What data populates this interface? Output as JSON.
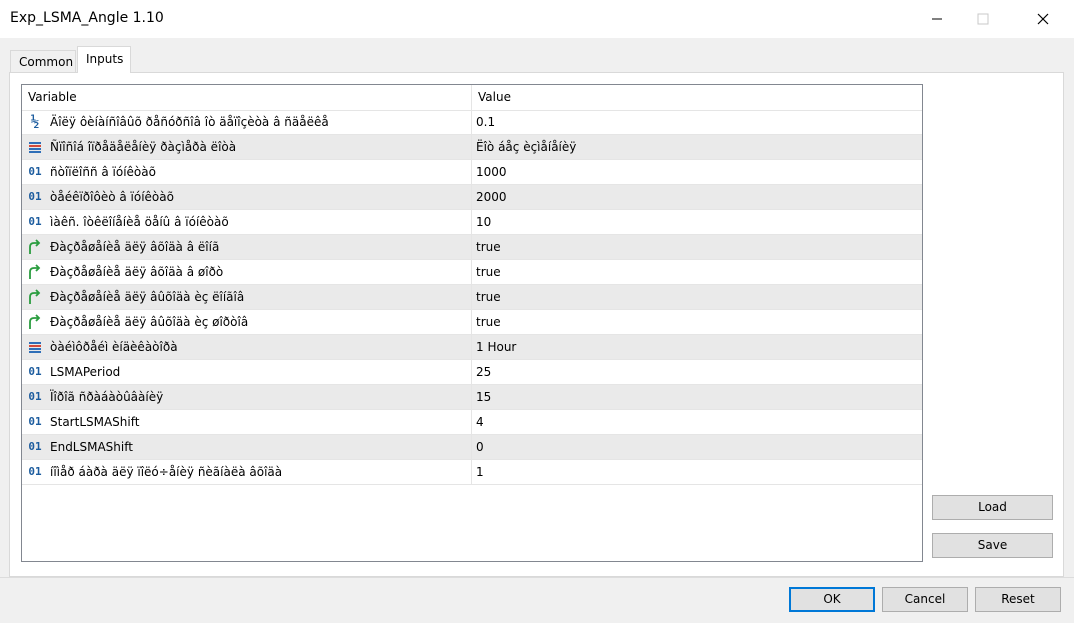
{
  "window": {
    "title": "Exp_LSMA_Angle 1.10"
  },
  "tabs": [
    {
      "label": "Common",
      "active": false
    },
    {
      "label": "Inputs",
      "active": true
    }
  ],
  "grid": {
    "columns": [
      "Variable",
      "Value"
    ],
    "rows": [
      {
        "icon": "fraction-icon",
        "name": "Äîëÿ ôèíàíñîâûõ ðåñóðñîâ îò äåïîçèòà â ñäåëêå",
        "value": "0.1"
      },
      {
        "icon": "enum-icon",
        "name": "Ñïîñîá îïðåäåëåíèÿ ðàçìåðà ëîòà",
        "value": "Ëîò áåç èçìåíåíèÿ"
      },
      {
        "icon": "int-icon",
        "name": "ñòîïëîññ â ïóíêòàõ",
        "value": "1000"
      },
      {
        "icon": "int-icon",
        "name": "òåéêïðîôèò â ïóíêòàõ",
        "value": "2000"
      },
      {
        "icon": "int-icon",
        "name": "ìàêñ. îòêëîíåíèå öåíû â ïóíêòàõ",
        "value": "10"
      },
      {
        "icon": "bool-icon",
        "name": "Ðàçðåøåíèå äëÿ âõîäà â ëîíã",
        "value": "true"
      },
      {
        "icon": "bool-icon",
        "name": "Ðàçðåøåíèå äëÿ âõîäà â øîðò",
        "value": "true"
      },
      {
        "icon": "bool-icon",
        "name": "Ðàçðåøåíèå äëÿ âûõîäà èç ëîíãîâ",
        "value": "true"
      },
      {
        "icon": "bool-icon",
        "name": "Ðàçðåøåíèå äëÿ âûõîäà èç øîðòîâ",
        "value": "true"
      },
      {
        "icon": "enum-icon",
        "name": "òàéìôðåéì èíäèêàòîðà",
        "value": "1 Hour"
      },
      {
        "icon": "int-icon",
        "name": "LSMAPeriod",
        "value": "25"
      },
      {
        "icon": "int-icon",
        "name": "Ïîðîã ñðàáàòûâàíèÿ",
        "value": "15"
      },
      {
        "icon": "int-icon",
        "name": "StartLSMAShift",
        "value": "4"
      },
      {
        "icon": "int-icon",
        "name": "EndLSMAShift",
        "value": "0"
      },
      {
        "icon": "int-icon",
        "name": "íîìåð áàðà äëÿ ïîëó÷åíèÿ ñèãíàëà âõîäà",
        "value": "1"
      }
    ]
  },
  "side_buttons": {
    "load": "Load",
    "save": "Save"
  },
  "footer_buttons": {
    "ok": "OK",
    "cancel": "Cancel",
    "reset": "Reset"
  },
  "icon_glyphs": {
    "int": "01",
    "fraction": "½"
  },
  "colors": {
    "accent": "#0078d7",
    "icon_blue": "#1c5c9e",
    "icon_green": "#2a9d3f",
    "row_alt": "#eaeaea"
  }
}
